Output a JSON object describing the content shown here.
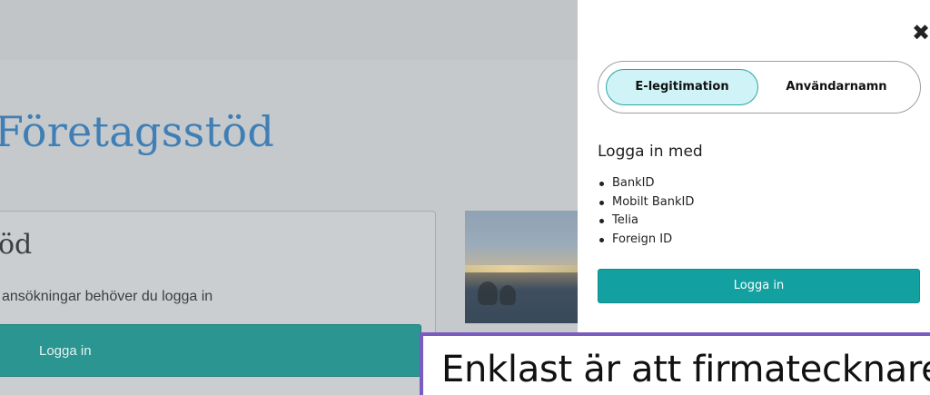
{
  "background_page": {
    "title": "Företagsstöd",
    "card_heading": "öd",
    "card_text": "ansökningar behöver du logga in",
    "login_button_label": "Logga in"
  },
  "panel": {
    "close_icon": "close-x-icon",
    "tabs": [
      {
        "label": "E-legitimation",
        "active": true
      },
      {
        "label": "Användarnamn",
        "active": false
      }
    ],
    "heading": "Logga in med",
    "methods": [
      "BankID",
      "Mobilt BankID",
      "Telia",
      "Foreign ID"
    ],
    "login_button_label": "Logga in",
    "accent_color": "#12a0a0"
  },
  "overlay": {
    "text": "Enklast är att firmatecknare",
    "border_color": "#7a5bbf"
  }
}
